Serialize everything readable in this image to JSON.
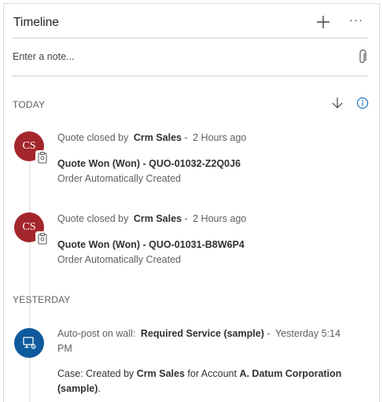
{
  "header": {
    "title": "Timeline"
  },
  "note": {
    "placeholder": "Enter a note..."
  },
  "sections": {
    "today": "TODAY",
    "yesterday": "YESTERDAY"
  },
  "activities": [
    {
      "avatar_initials": "CS",
      "action": "Quote closed by",
      "user": "Crm Sales",
      "sep": "-",
      "time": "2 Hours ago",
      "title": "Quote Won (Won) - QUO-01032-Z2Q0J6",
      "detail": "Order Automatically Created"
    },
    {
      "avatar_initials": "CS",
      "action": "Quote closed by",
      "user": "Crm Sales",
      "sep": "-",
      "time": "2 Hours ago",
      "title": "Quote Won (Won) - QUO-01031-B8W6P4",
      "detail": "Order Automatically Created"
    },
    {
      "action": "Auto-post on wall:",
      "subject": "Required Service (sample)",
      "sep": "-",
      "time_1": "Yesterday 5:14",
      "time_2": "PM",
      "detail_pre": "Case: Created by",
      "detail_user": "Crm Sales",
      "detail_mid": "for Account",
      "detail_account": "A. Datum Corporation",
      "detail_account_2": "(sample)",
      "detail_end": "."
    }
  ],
  "colors": {
    "avatar_red": "#a4262c",
    "avatar_blue": "#0f5a9d",
    "info_blue": "#0f6cbd"
  }
}
